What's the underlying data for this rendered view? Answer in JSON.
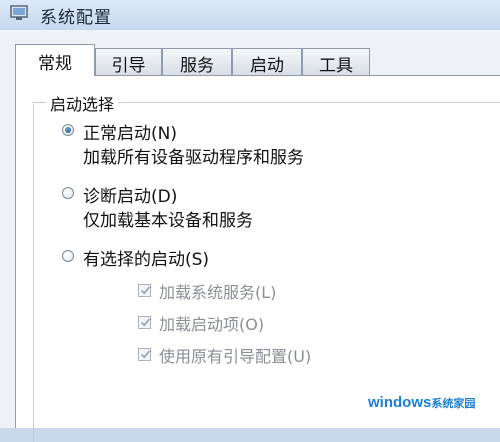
{
  "window": {
    "title": "系统配置"
  },
  "tabs": [
    {
      "label": "常规",
      "active": true
    },
    {
      "label": "引导",
      "active": false
    },
    {
      "label": "服务",
      "active": false
    },
    {
      "label": "启动",
      "active": false
    },
    {
      "label": "工具",
      "active": false
    }
  ],
  "startup_selection": {
    "legend": "启动选择",
    "options": [
      {
        "label": "正常启动(N)",
        "description": "加载所有设备驱动程序和服务",
        "selected": true
      },
      {
        "label": "诊断启动(D)",
        "description": "仅加载基本设备和服务",
        "selected": false
      },
      {
        "label": "有选择的启动(S)",
        "description": "",
        "selected": false
      }
    ],
    "selective_items": [
      {
        "label": "加载系统服务(L)",
        "checked": true,
        "enabled": false
      },
      {
        "label": "加载启动项(O)",
        "checked": true,
        "enabled": false
      },
      {
        "label": "使用原有引导配置(U)",
        "checked": true,
        "enabled": false
      }
    ]
  },
  "watermark": {
    "brand": "windows",
    "suffix": "系统家园"
  },
  "colors": {
    "accent": "#1f4f8a",
    "disabled_text": "#8a8f96",
    "watermark": "#1c7fd1"
  }
}
